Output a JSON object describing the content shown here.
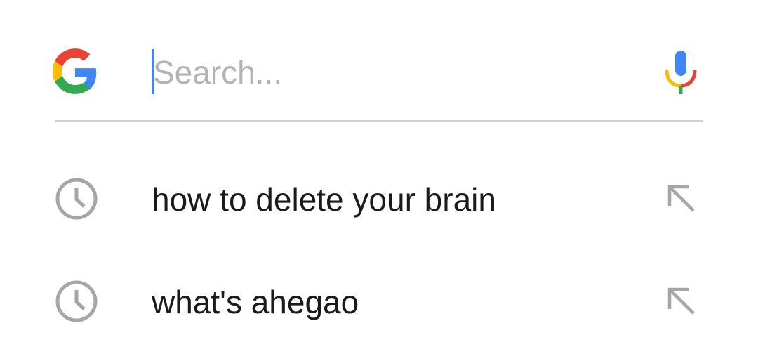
{
  "search": {
    "placeholder": "Search...",
    "value": "",
    "logo_icon": "google-g-logo",
    "voice_icon": "microphone-icon"
  },
  "suggestions": [
    {
      "text": "how to delete your brain",
      "icon": "history-clock-icon",
      "action_icon": "fill-arrow-icon"
    },
    {
      "text": "what's ahegao",
      "icon": "history-clock-icon",
      "action_icon": "fill-arrow-icon"
    }
  ],
  "colors": {
    "google_blue": "#4285F4",
    "google_red": "#EA4335",
    "google_yellow": "#FBBC05",
    "google_green": "#34A853",
    "placeholder_gray": "#b3b3b3",
    "icon_gray": "#a6a6a6",
    "divider": "#d2d2d2"
  }
}
